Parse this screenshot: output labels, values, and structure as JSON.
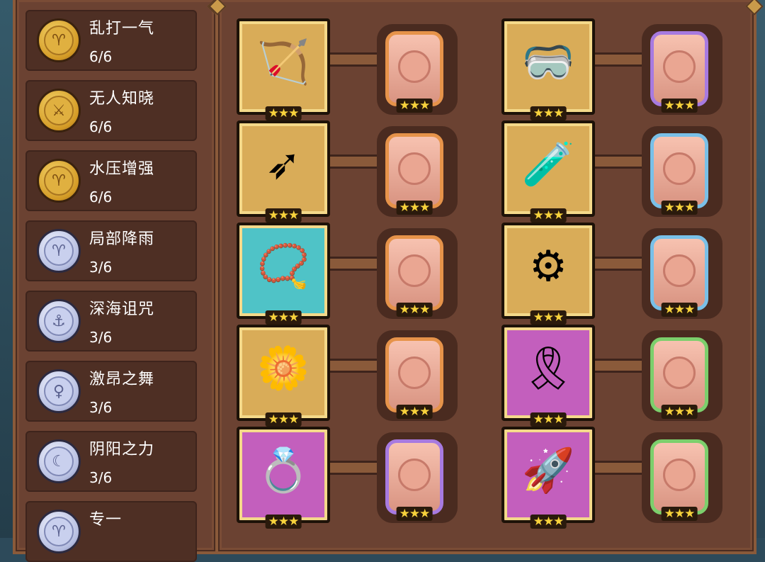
{
  "bonds": [
    {
      "name": "乱打一气",
      "count": "6/6",
      "tier": "gold",
      "icon": "fist-icon",
      "glyph": "♈"
    },
    {
      "name": "无人知晓",
      "count": "6/6",
      "tier": "gold",
      "icon": "blade-icon",
      "glyph": "⚔"
    },
    {
      "name": "水压增强",
      "count": "6/6",
      "tier": "gold",
      "icon": "fist-icon",
      "glyph": "♈"
    },
    {
      "name": "局部降雨",
      "count": "3/6",
      "tier": "silver",
      "icon": "fist-icon",
      "glyph": "♈"
    },
    {
      "name": "深海诅咒",
      "count": "3/6",
      "tier": "silver",
      "icon": "anchor-icon",
      "glyph": "⚓"
    },
    {
      "name": "激昂之舞",
      "count": "3/6",
      "tier": "silver",
      "icon": "dancer-icon",
      "glyph": "♀"
    },
    {
      "name": "阴阳之力",
      "count": "3/6",
      "tier": "silver",
      "icon": "moon-icon",
      "glyph": "☾"
    },
    {
      "name": "专一",
      "count": "",
      "tier": "silver",
      "icon": "fist-icon",
      "glyph": "♈"
    }
  ],
  "items_left": [
    {
      "icon": "crossbow-icon",
      "glyph": "🏹",
      "rarity": "gold",
      "stars": "★★★",
      "slot_color": "orange",
      "slot_stars": "★★★"
    },
    {
      "icon": "arrow-icon",
      "glyph": "➶",
      "rarity": "gold",
      "stars": "★★★",
      "slot_color": "orange",
      "slot_stars": "★★★"
    },
    {
      "icon": "heart-necklace-icon",
      "glyph": "📿",
      "rarity": "teal",
      "stars": "★★★",
      "slot_color": "orange",
      "slot_stars": "★★★"
    },
    {
      "icon": "eye-flower-icon",
      "glyph": "🌼",
      "rarity": "gold",
      "stars": "★★★",
      "slot_color": "orange",
      "slot_stars": "★★★"
    },
    {
      "icon": "frog-ring-icon",
      "glyph": "💍",
      "rarity": "purple",
      "stars": "★★★",
      "slot_color": "purple",
      "slot_stars": "★★★"
    }
  ],
  "items_right": [
    {
      "icon": "goggles-icon",
      "glyph": "🥽",
      "rarity": "gold",
      "stars": "★★★",
      "slot_color": "purple",
      "slot_stars": "★★★"
    },
    {
      "icon": "oxygen-tank-icon",
      "glyph": "🧪",
      "rarity": "gold",
      "stars": "★★★",
      "slot_color": "blue",
      "slot_stars": "★★★"
    },
    {
      "icon": "spiked-ring-icon",
      "glyph": "⚙",
      "rarity": "gold",
      "stars": "★★★",
      "slot_color": "blue",
      "slot_stars": "★★★"
    },
    {
      "icon": "belt-icon",
      "glyph": "🎗",
      "rarity": "purple",
      "stars": "★★★",
      "slot_color": "green",
      "slot_stars": "★★★"
    },
    {
      "icon": "jet-fins-icon",
      "glyph": "🚀",
      "rarity": "purple",
      "stars": "★★★",
      "slot_color": "green",
      "slot_stars": "★★★"
    }
  ]
}
